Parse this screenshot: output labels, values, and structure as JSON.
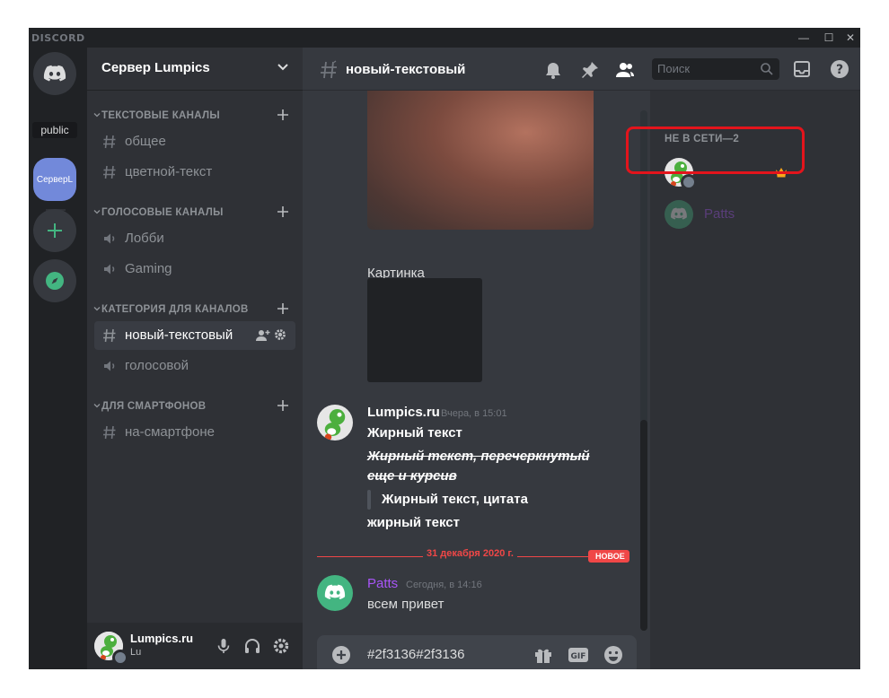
{
  "window": {
    "brand": "DISCORD"
  },
  "rail": {
    "tooltip": "public",
    "active_server_label": "СерверL"
  },
  "server": {
    "name": "Сервер Lumpics"
  },
  "categories": [
    {
      "label": "ТЕКСТОВЫЕ КАНАЛЫ",
      "channels": [
        {
          "name": "общее",
          "type": "text"
        },
        {
          "name": "цветной-текст",
          "type": "text"
        }
      ]
    },
    {
      "label": "ГОЛОСОВЫЕ КАНАЛЫ",
      "channels": [
        {
          "name": "Лобби",
          "type": "voice"
        },
        {
          "name": "Gaming",
          "type": "voice"
        }
      ]
    },
    {
      "label": "КАТЕГОРИЯ ДЛЯ КАНАЛОВ",
      "channels": [
        {
          "name": "новый-текстовый",
          "type": "text",
          "active": true
        },
        {
          "name": "голосовой",
          "type": "voice"
        }
      ]
    },
    {
      "label": "ДЛЯ СМАРТФОНОВ",
      "channels": [
        {
          "name": "на-смартфоне",
          "type": "text"
        }
      ]
    }
  ],
  "user_panel": {
    "name": "Lumpics.ru",
    "tag": "Lu"
  },
  "chat": {
    "channel_title": "новый-текстовый",
    "search_placeholder": "Поиск",
    "image_caption": "Картинка",
    "messages": [
      {
        "author": "Lumpics.ru",
        "time": "Вчера, в 15:01",
        "lines": [
          "Жирный текст",
          "Жирный текст, перечеркнутый",
          "еще и курсив",
          "Жирный текст, цитата",
          "жирный текст"
        ]
      },
      {
        "author": "Patts",
        "time": "Сегодня, в 14:16",
        "lines": [
          "всем привет"
        ]
      }
    ],
    "date_divider": "31 декабря 2020 г.",
    "new_badge": "НОВОЕ",
    "composer_text": "#2f3136#2f3136"
  },
  "members": {
    "group_label": "НЕ В СЕТИ—2",
    "list": [
      {
        "name": "",
        "owner": true
      },
      {
        "name": "Patts",
        "owner": false
      }
    ]
  },
  "colors": {
    "accent": "#7289da",
    "online_green": "#43b581",
    "patts_purple": "#a855f7",
    "alert_red": "#f04747",
    "crown": "#faa61a"
  }
}
